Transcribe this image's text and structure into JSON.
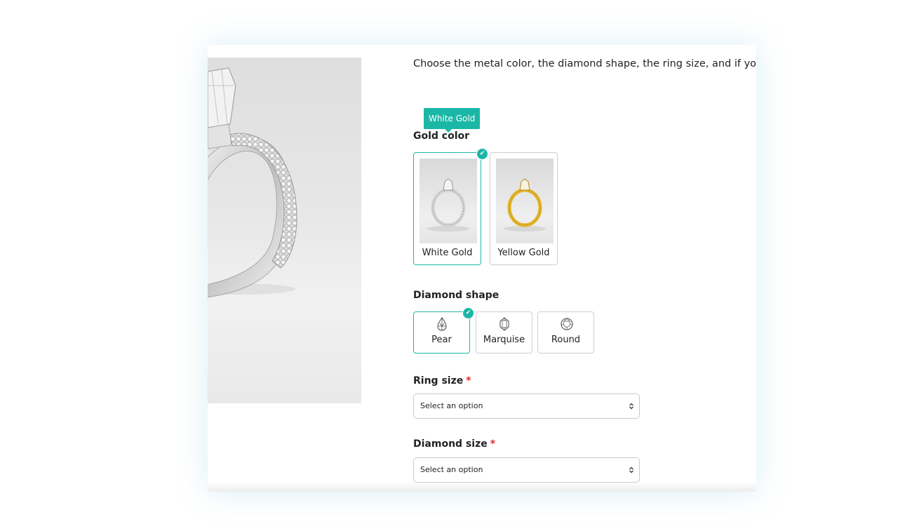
{
  "intro_text": "Choose the metal color, the diamond shape, the ring size, and if you want to add engraving.",
  "gold_color": {
    "tooltip": "White Gold",
    "label": "Gold color",
    "options": [
      {
        "label": "White Gold",
        "selected": true,
        "metal": "#d5d5d5"
      },
      {
        "label": "Yellow Gold",
        "selected": false,
        "metal": "#e3b52b"
      }
    ]
  },
  "diamond_shape": {
    "label": "Diamond shape",
    "options": [
      {
        "label": "Pear",
        "icon": "pear-icon",
        "selected": true
      },
      {
        "label": "Marquise",
        "icon": "marquise-icon",
        "selected": false
      },
      {
        "label": "Round",
        "icon": "round-icon",
        "selected": false
      }
    ]
  },
  "ring_size": {
    "label": "Ring size",
    "required_mark": "*",
    "value": "Select an option"
  },
  "diamond_size": {
    "label": "Diamond size",
    "required_mark": "*",
    "value": "Select an option"
  },
  "colors": {
    "accent": "#1bb7a6",
    "required": "#e0262d"
  }
}
